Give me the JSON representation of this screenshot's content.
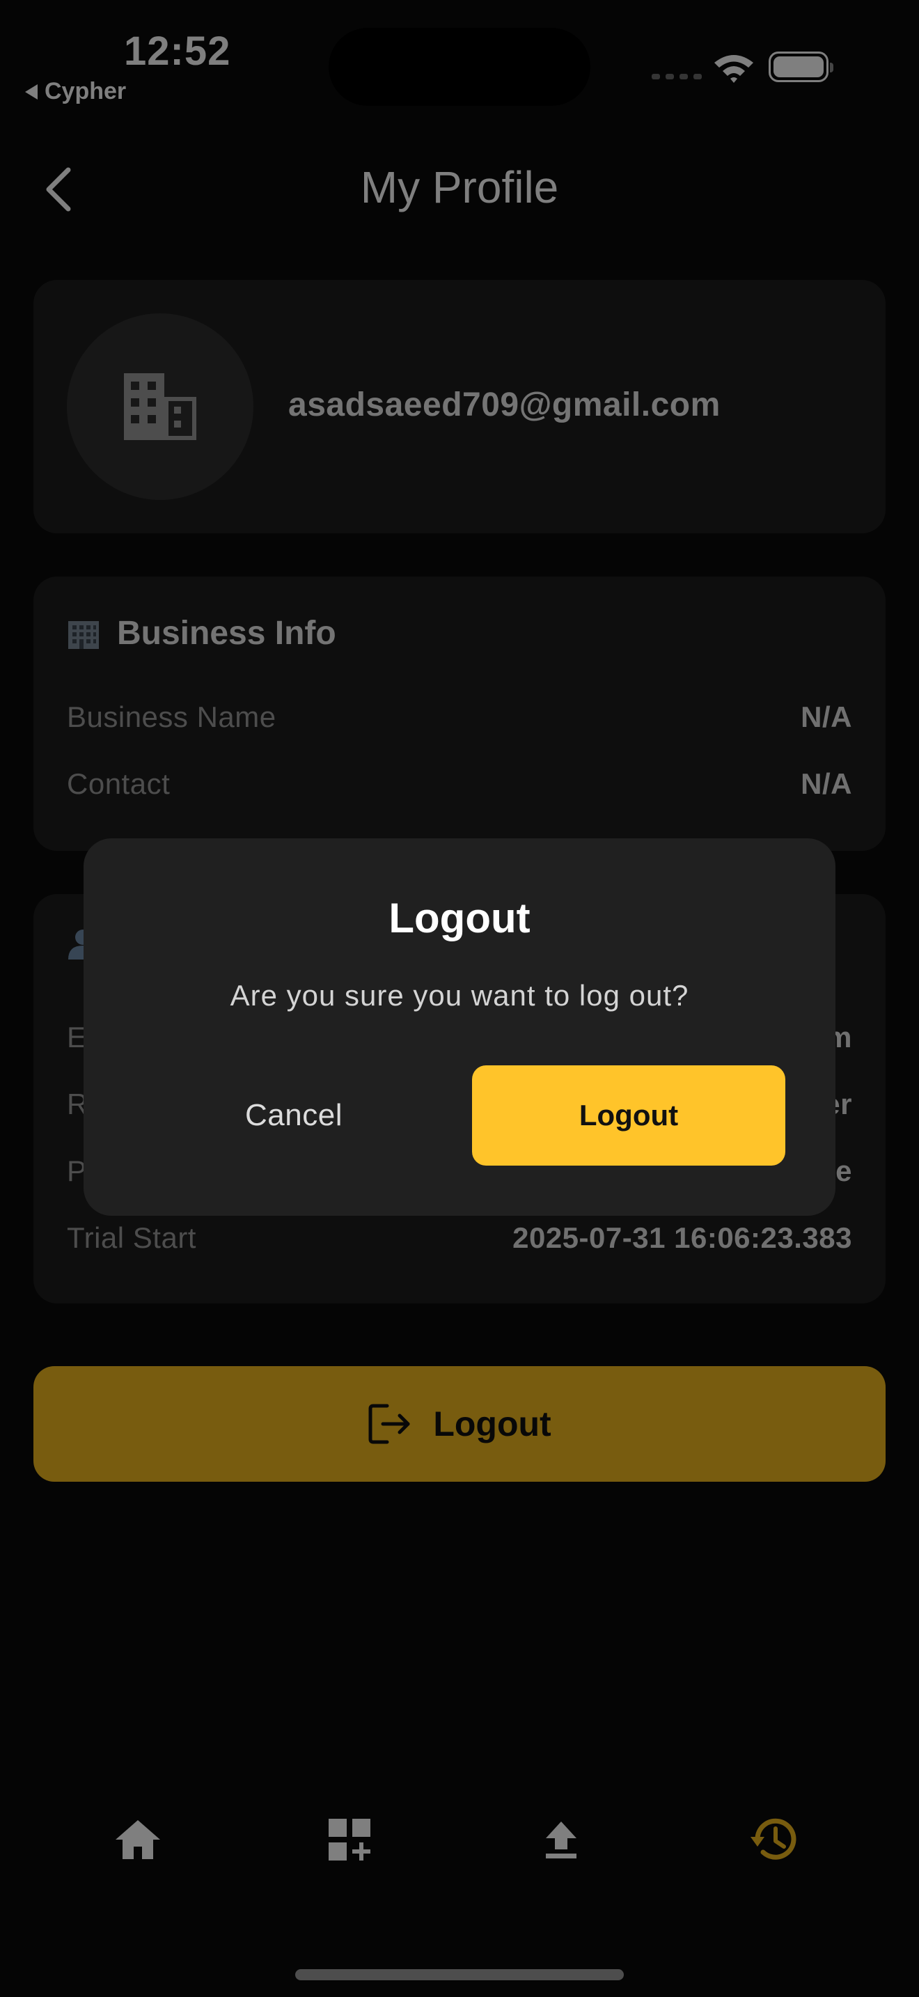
{
  "status_bar": {
    "time": "12:52",
    "back_app": "Cypher"
  },
  "header": {
    "title": "My Profile"
  },
  "profile": {
    "email": "asadsaeed709@gmail.com",
    "avatar_icon": "building-icon"
  },
  "business_info": {
    "title": "Business Info",
    "icon": "office-building-icon",
    "rows": [
      {
        "label": "Business Name",
        "value": "N/A"
      },
      {
        "label": "Contact",
        "value": "N/A"
      }
    ]
  },
  "account_info": {
    "visible_row_initials": [
      "E",
      "R",
      "P"
    ],
    "visible_value_tails": [
      "m",
      "er",
      "e"
    ],
    "trial_start_label": "Trial Start",
    "trial_start_value": "2025-07-31 16:06:23.383"
  },
  "logout_button": {
    "label": "Logout",
    "icon": "logout-icon"
  },
  "bottom_nav": {
    "items": [
      {
        "icon": "home-icon"
      },
      {
        "icon": "add-widget-icon"
      },
      {
        "icon": "upload-icon"
      },
      {
        "icon": "history-icon",
        "active": true
      }
    ],
    "active_color": "#f0b91e"
  },
  "dialog": {
    "title": "Logout",
    "message": "Are you sure you want to log out?",
    "cancel_label": "Cancel",
    "confirm_label": "Logout"
  },
  "colors": {
    "background": "#0b0b0b",
    "card": "#1c1c1c",
    "accent": "#ffc42a"
  }
}
